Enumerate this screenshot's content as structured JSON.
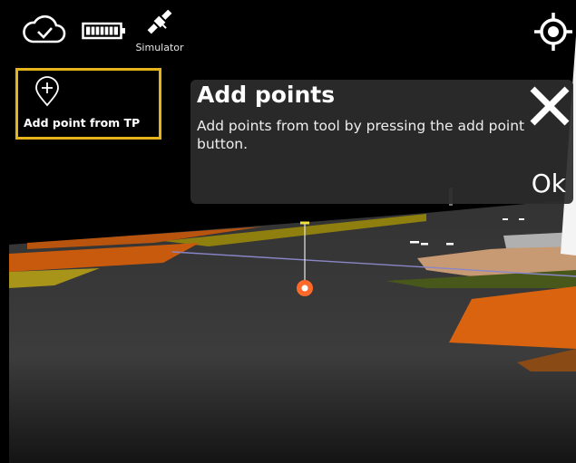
{
  "status_bar": {
    "cloud_icon": "cloud-check-icon",
    "battery_icon": "battery-icon",
    "satellite_icon": "satellite-icon",
    "simulator_label": "Simulator",
    "locate_icon": "crosshair-locate-icon"
  },
  "tool_button": {
    "label": "Add point from TP",
    "icon": "add-pin-icon",
    "highlight_color": "#e5b41b"
  },
  "dialog": {
    "title": "Add points",
    "message": "Add points from tool by pressing the add point button.",
    "ok_label": "Ok",
    "close_icon": "close-icon"
  },
  "scene": {
    "ground_color": "#3a3a3a",
    "surface_orange": "#d9630f",
    "surface_yellow": "#9a8a10",
    "surface_green": "#4a5a1a",
    "point_marker_color": "#ff6a2b"
  }
}
